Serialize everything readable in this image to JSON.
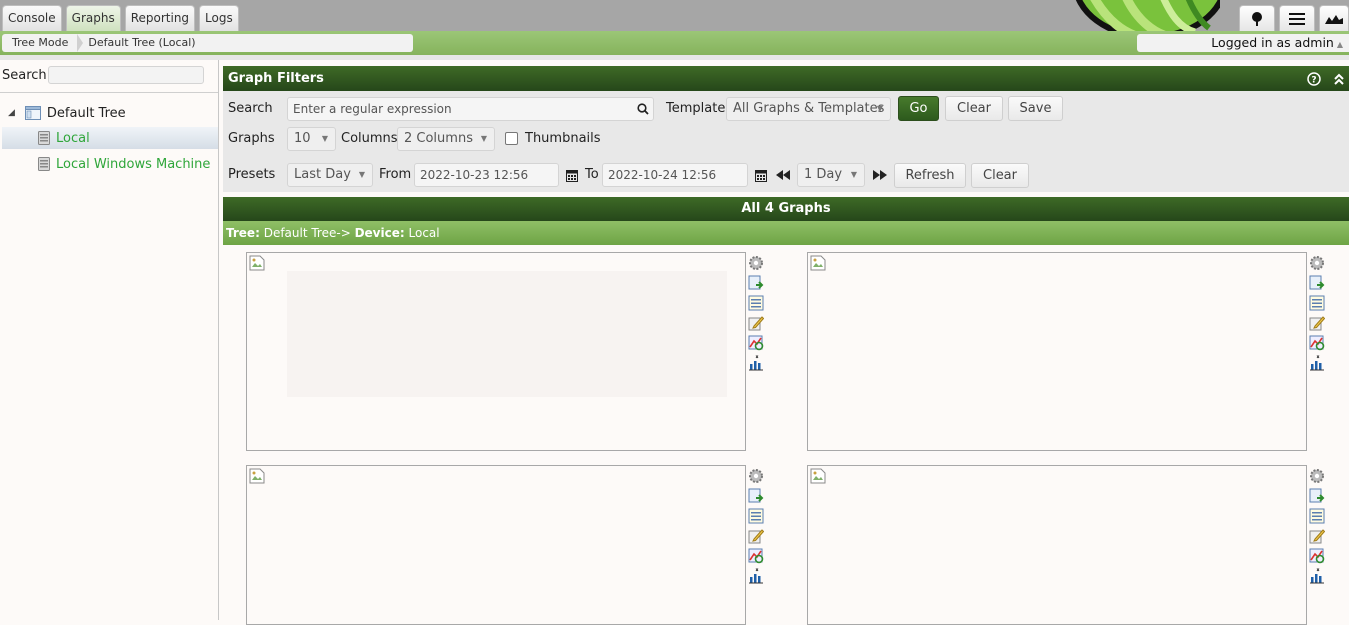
{
  "tabs": [
    {
      "label": "Console"
    },
    {
      "label": "Graphs"
    },
    {
      "label": "Reporting"
    },
    {
      "label": "Logs"
    }
  ],
  "breadcrumb": {
    "items": [
      "Tree Mode",
      "Default Tree (Local)"
    ]
  },
  "login": {
    "text": "Logged in as admin"
  },
  "tree": {
    "search_label": "Search",
    "root": "Default Tree",
    "nodes": [
      "Local",
      "Local Windows Machine"
    ]
  },
  "filters": {
    "title": "Graph Filters",
    "search_label": "Search",
    "search_placeholder": "Enter a regular expression",
    "template_label": "Template",
    "template_value": "All Graphs & Templates",
    "go": "Go",
    "clear": "Clear",
    "save": "Save",
    "graphs_label": "Graphs",
    "graphs_value": "10",
    "columns_label": "Columns",
    "columns_value": "2 Columns",
    "thumbnails_label": "Thumbnails",
    "presets_label": "Presets",
    "presets_value": "Last Day",
    "from_label": "From",
    "from_value": "2022-10-23 12:56",
    "to_label": "To",
    "to_value": "2022-10-24 12:56",
    "span_value": "1 Day",
    "refresh": "Refresh",
    "clear2": "Clear"
  },
  "graph_list": {
    "header": "All 4 Graphs",
    "tree_label": "Tree:",
    "tree_value": "Default Tree->",
    "device_label": "Device:",
    "device_value": "Local"
  },
  "colors": {
    "dark_green": "#2d5a1d",
    "light_green": "#86b35c",
    "node_green": "#2fa63a"
  }
}
